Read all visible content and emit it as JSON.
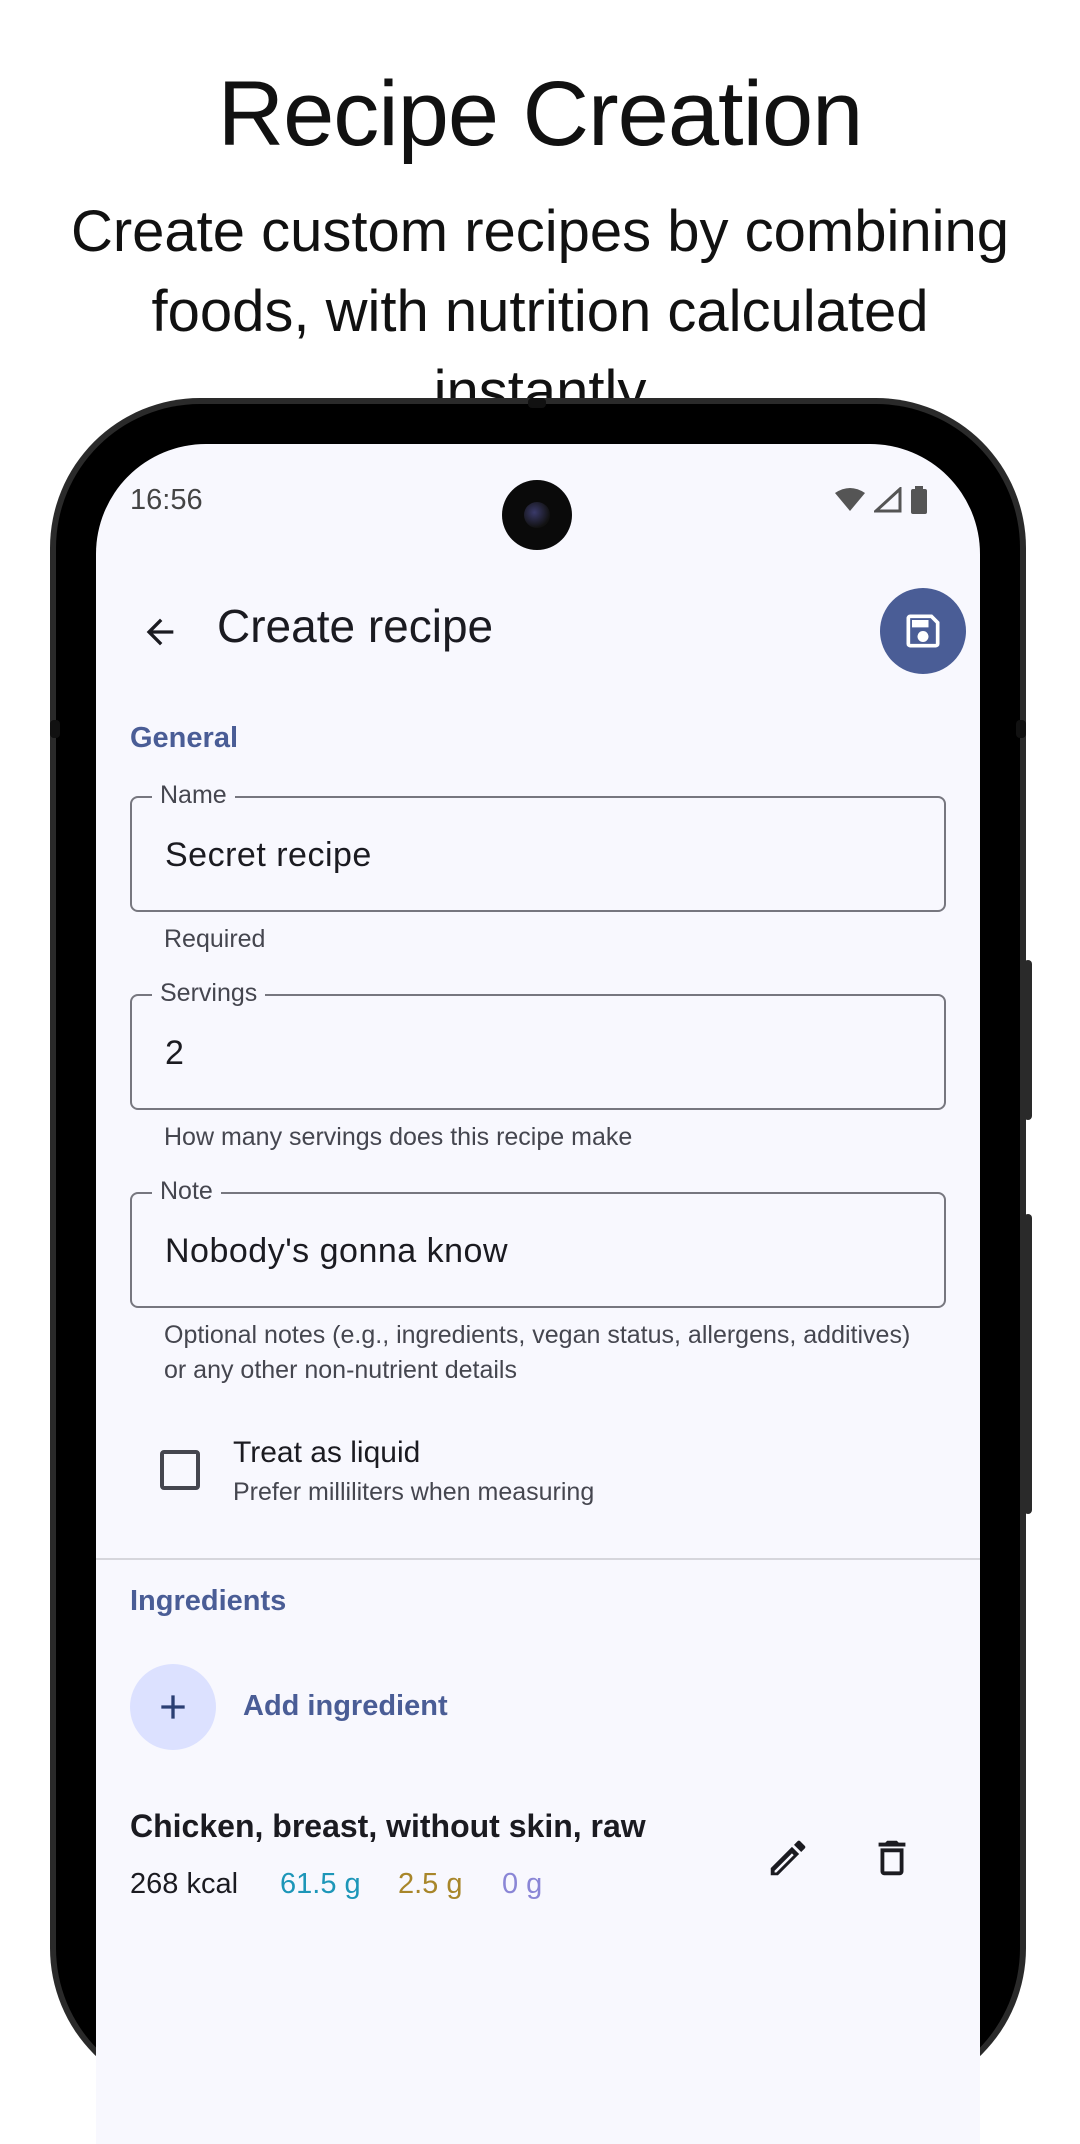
{
  "promo": {
    "title": "Recipe Creation",
    "subtitle": "Create custom recipes by combining foods, with nutrition calculated instantly"
  },
  "status_bar": {
    "time": "16:56",
    "icons": [
      "wifi-icon",
      "signal-icon",
      "battery-icon"
    ]
  },
  "top_bar": {
    "title": "Create recipe",
    "back_icon": "arrow-back-icon",
    "save_icon": "save-icon"
  },
  "general": {
    "section_label": "General",
    "name": {
      "label": "Name",
      "value": "Secret recipe",
      "helper": "Required"
    },
    "servings": {
      "label": "Servings",
      "value": "2",
      "helper": "How many servings does this recipe make"
    },
    "note": {
      "label": "Note",
      "value": "Nobody's gonna know",
      "helper": "Optional notes (e.g., ingredients, vegan status, allergens, additives) or any other non-nutrient details"
    },
    "liquid": {
      "title": "Treat as liquid",
      "subtitle": "Prefer milliliters when measuring",
      "checked": false
    }
  },
  "ingredients": {
    "section_label": "Ingredients",
    "add_label": "Add ingredient",
    "items": [
      {
        "name": "Chicken, breast, without skin, raw",
        "kcal": "268 kcal",
        "protein": "61.5 g",
        "fat": "2.5 g",
        "carbs": "0 g"
      }
    ]
  },
  "colors": {
    "accent": "#4a5d96",
    "protein": "#1d96b8",
    "fat": "#a8862a",
    "carbs": "#8a86d6",
    "screen_bg": "#f8f8fe"
  }
}
